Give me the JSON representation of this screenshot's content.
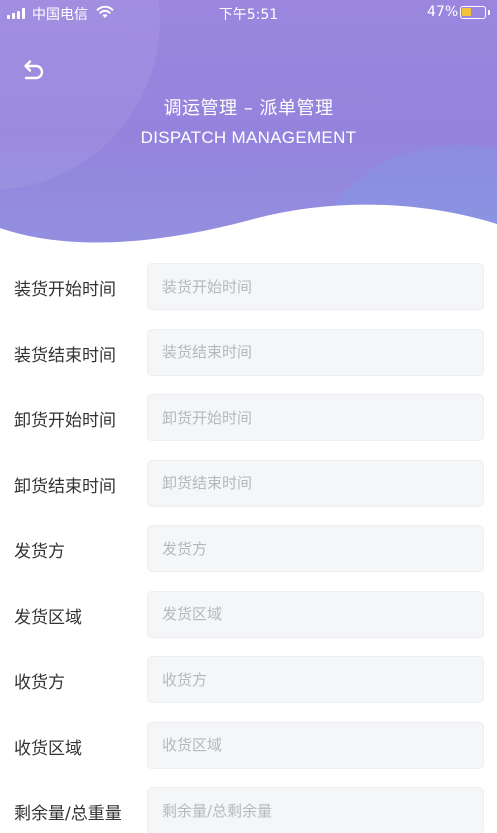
{
  "status_bar": {
    "carrier": "中国电信",
    "time": "下午5:51",
    "battery_percent": "47%",
    "battery_level": 0.47
  },
  "header": {
    "back_icon": "undo-arrow-icon",
    "title_cn": "调运管理 – 派单管理",
    "title_en": "DISPATCH MANAGEMENT"
  },
  "colors": {
    "header_gradient_start": "#9a86de",
    "header_gradient_end": "#9390e0",
    "input_background": "#f5f6f8",
    "placeholder_text": "#b5b8bd",
    "label_text": "#333333"
  },
  "form": {
    "fields": [
      {
        "label": "装货开始时间",
        "placeholder": "装货开始时间",
        "value": ""
      },
      {
        "label": "装货结束时间",
        "placeholder": "装货结束时间",
        "value": ""
      },
      {
        "label": "卸货开始时间",
        "placeholder": "卸货开始时间",
        "value": ""
      },
      {
        "label": "卸货结束时间",
        "placeholder": "卸货结束时间",
        "value": ""
      },
      {
        "label": "发货方",
        "placeholder": "发货方",
        "value": ""
      },
      {
        "label": "发货区域",
        "placeholder": "发货区域",
        "value": ""
      },
      {
        "label": "收货方",
        "placeholder": "收货方",
        "value": ""
      },
      {
        "label": "收货区域",
        "placeholder": "收货区域",
        "value": ""
      },
      {
        "label": "剩余量/总重量",
        "placeholder": "剩余量/总剩余量",
        "value": ""
      }
    ]
  }
}
